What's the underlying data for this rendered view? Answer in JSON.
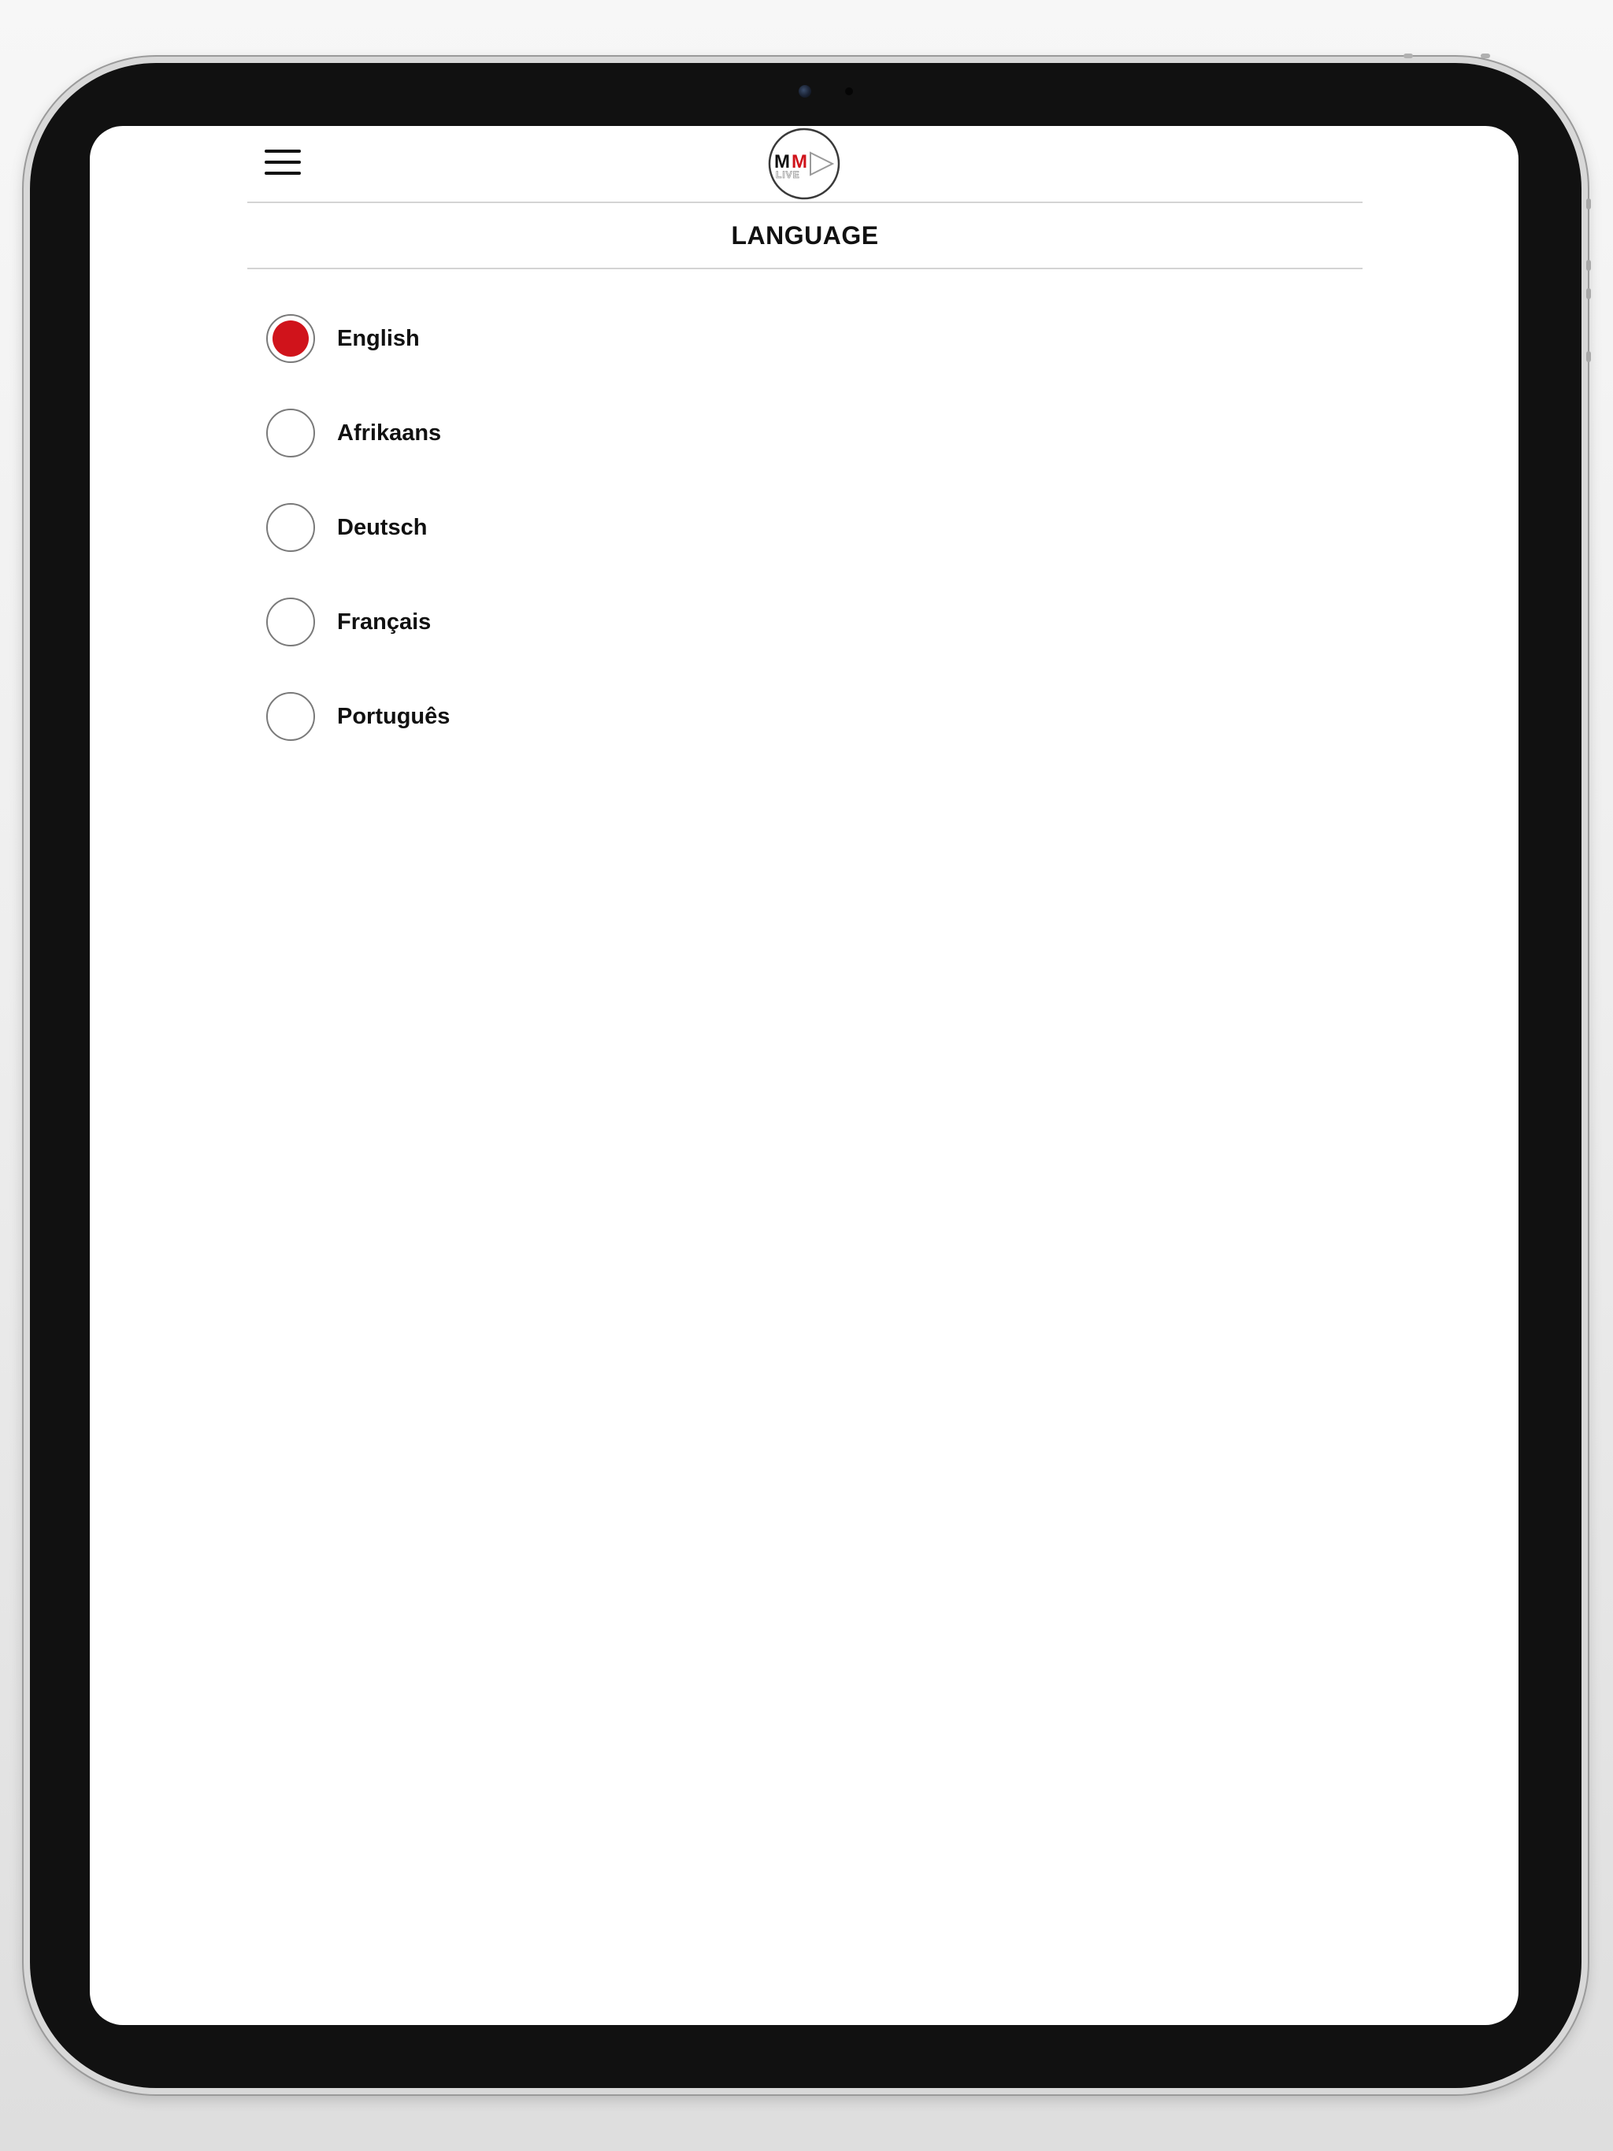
{
  "header": {
    "menu_icon": "hamburger-menu-icon",
    "logo": {
      "text_primary": "MM",
      "text_secondary": "LIVE",
      "colors": {
        "black": "#111111",
        "red": "#d0131b",
        "grey": "#9a9a9a"
      }
    }
  },
  "page": {
    "title": "LANGUAGE"
  },
  "languages": [
    {
      "label": "English",
      "selected": true
    },
    {
      "label": "Afrikaans",
      "selected": false
    },
    {
      "label": "Deutsch",
      "selected": false
    },
    {
      "label": "Français",
      "selected": false
    },
    {
      "label": "Português",
      "selected": false
    }
  ],
  "theme": {
    "accent": "#d0131b",
    "text": "#111111",
    "divider": "#d4d4d4"
  }
}
